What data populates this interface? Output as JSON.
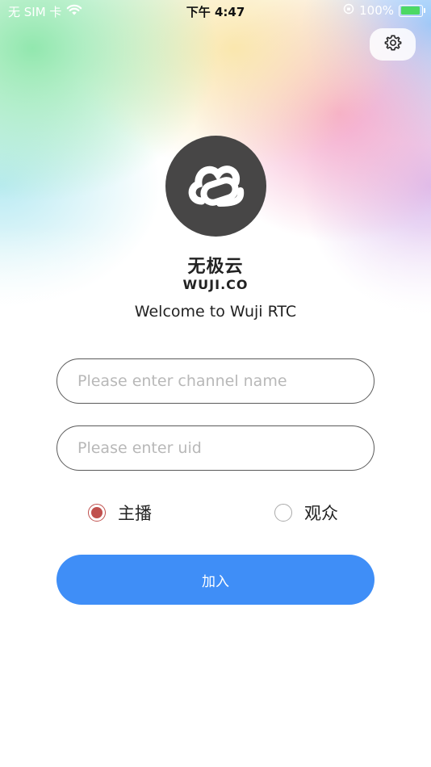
{
  "status_bar": {
    "carrier": "无 SIM 卡",
    "time": "下午 4:47",
    "battery": "100%"
  },
  "icons": {
    "settings": "gear-icon",
    "logo": "cloud-link-icon",
    "wifi": "wifi-icon"
  },
  "brand": {
    "name_cn": "无极云",
    "name_en": "WUJI.CO",
    "welcome": "Welcome to Wuji RTC"
  },
  "form": {
    "channel_placeholder": "Please enter channel name",
    "channel_value": "",
    "uid_placeholder": "Please enter uid",
    "uid_value": "",
    "roles": [
      {
        "label": "主播",
        "selected": true
      },
      {
        "label": "观众",
        "selected": false
      }
    ],
    "join_label": "加入"
  },
  "colors": {
    "accent": "#3f8ef7",
    "radio_selected": "#c0504d",
    "logo_bg": "#474646"
  }
}
